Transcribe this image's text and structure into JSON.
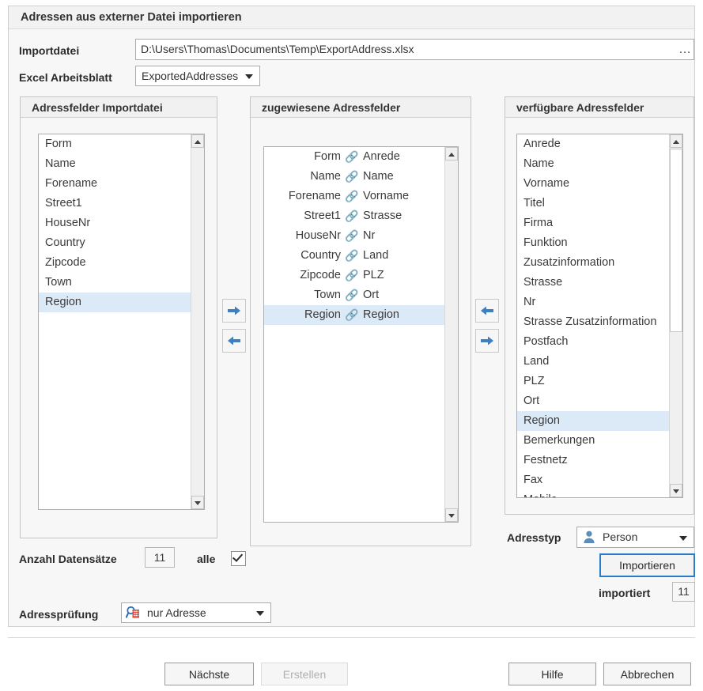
{
  "dialog": {
    "title": "Adressen aus externer Datei importieren"
  },
  "form": {
    "import_file_label": "Importdatei",
    "import_file_value": "D:\\Users\\Thomas\\Documents\\Temp\\ExportAddress.xlsx",
    "browse_label": "…",
    "worksheet_label": "Excel Arbeitsblatt",
    "worksheet_value": "ExportedAddresses"
  },
  "source_panel": {
    "header": "Adressfelder Importdatei",
    "items": [
      {
        "label": "Form",
        "selected": false
      },
      {
        "label": "Name",
        "selected": false
      },
      {
        "label": "Forename",
        "selected": false
      },
      {
        "label": "Street1",
        "selected": false
      },
      {
        "label": "HouseNr",
        "selected": false
      },
      {
        "label": "Country",
        "selected": false
      },
      {
        "label": "Zipcode",
        "selected": false
      },
      {
        "label": "Town",
        "selected": false
      },
      {
        "label": "Region",
        "selected": true
      }
    ]
  },
  "mapped_panel": {
    "header": "zugewiesene Adressfelder",
    "link_icon": "🔗",
    "rows": [
      {
        "source": "Form",
        "target": "Anrede",
        "selected": false
      },
      {
        "source": "Name",
        "target": "Name",
        "selected": false
      },
      {
        "source": "Forename",
        "target": "Vorname",
        "selected": false
      },
      {
        "source": "Street1",
        "target": "Strasse",
        "selected": false
      },
      {
        "source": "HouseNr",
        "target": "Nr",
        "selected": false
      },
      {
        "source": "Country",
        "target": "Land",
        "selected": false
      },
      {
        "source": "Zipcode",
        "target": "PLZ",
        "selected": false
      },
      {
        "source": "Town",
        "target": "Ort",
        "selected": false
      },
      {
        "source": "Region",
        "target": "Region",
        "selected": true
      }
    ]
  },
  "available_panel": {
    "header": "verfügbare Adressfelder",
    "items": [
      {
        "label": "Anrede",
        "selected": false
      },
      {
        "label": "Name",
        "selected": false
      },
      {
        "label": "Vorname",
        "selected": false
      },
      {
        "label": "Titel",
        "selected": false
      },
      {
        "label": "Firma",
        "selected": false
      },
      {
        "label": "Funktion",
        "selected": false
      },
      {
        "label": "Zusatzinformation",
        "selected": false
      },
      {
        "label": "Strasse",
        "selected": false
      },
      {
        "label": "Nr",
        "selected": false
      },
      {
        "label": "Strasse Zusatzinformation",
        "selected": false
      },
      {
        "label": "Postfach",
        "selected": false
      },
      {
        "label": "Land",
        "selected": false
      },
      {
        "label": "PLZ",
        "selected": false
      },
      {
        "label": "Ort",
        "selected": false
      },
      {
        "label": "Region",
        "selected": true
      },
      {
        "label": "Bemerkungen",
        "selected": false
      },
      {
        "label": "Festnetz",
        "selected": false
      },
      {
        "label": "Fax",
        "selected": false
      },
      {
        "label": "Mobile",
        "selected": false
      }
    ]
  },
  "transfer_buttons": {
    "source_to_mapped": "arrow-right-icon",
    "mapped_to_source": "arrow-left-icon",
    "available_to_mapped": "arrow-left-icon",
    "mapped_to_available": "arrow-right-icon"
  },
  "counts": {
    "records_label": "Anzahl Datensätze",
    "records_value": "11",
    "all_label": "alle",
    "all_checked": true,
    "imported_label": "importiert",
    "imported_value": "11"
  },
  "address_check": {
    "label": "Adressprüfung",
    "value": "nur Adresse",
    "icon": "magnifier-building-icon"
  },
  "address_type": {
    "label": "Adresstyp",
    "value": "Person",
    "icon": "person-icon"
  },
  "actions": {
    "import_label": "Importieren"
  },
  "footer": {
    "next_label": "Nächste",
    "create_label": "Erstellen",
    "create_disabled": true,
    "help_label": "Hilfe",
    "cancel_label": "Abbrechen"
  },
  "colors": {
    "accent": "#2a7cc7",
    "selection": "#dceaf7",
    "panel_bg": "#f7f7f7",
    "link_blue": "#3f7fbf"
  }
}
